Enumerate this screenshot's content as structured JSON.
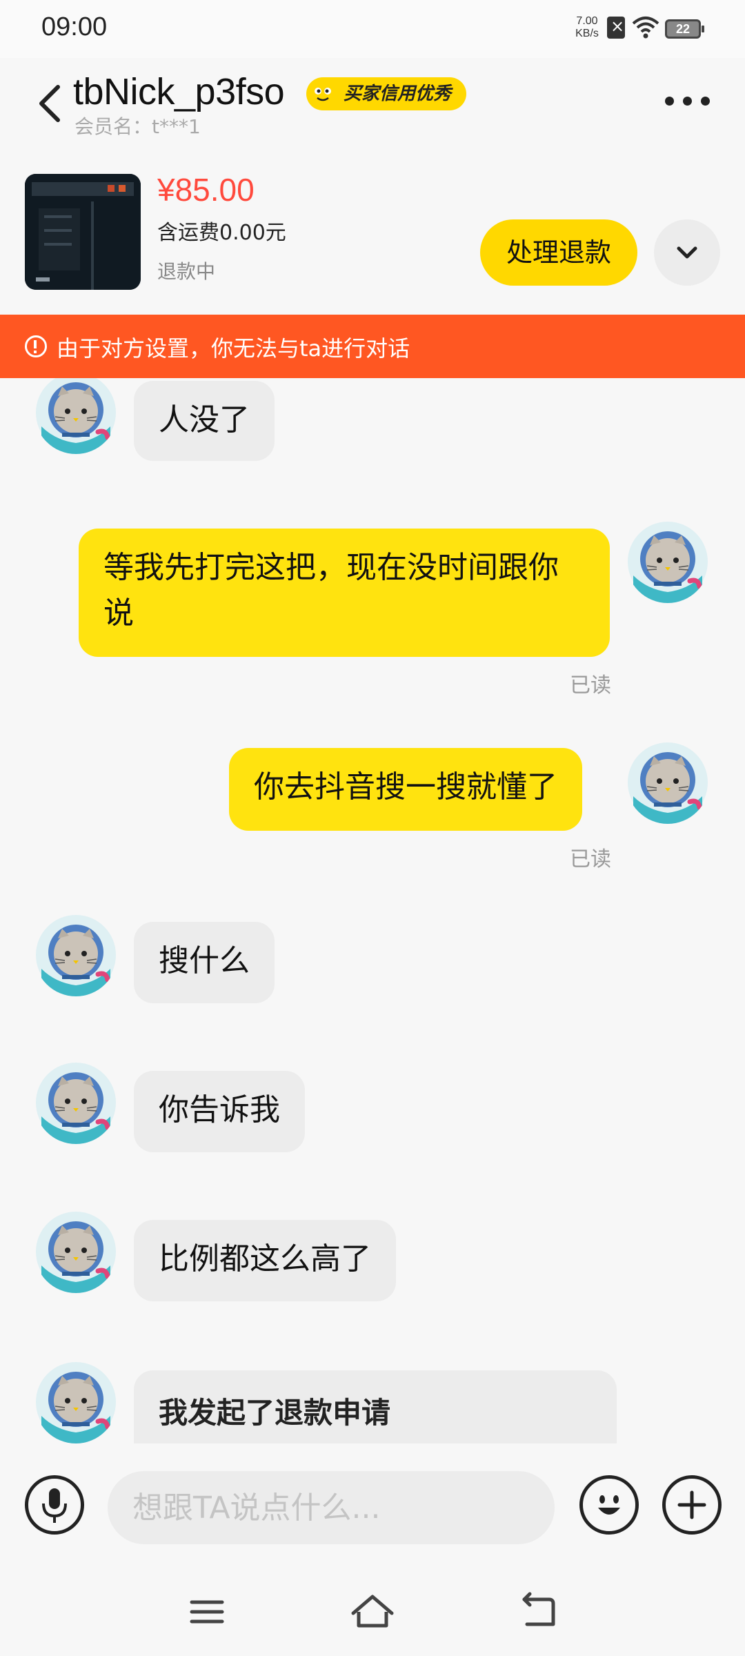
{
  "status_bar": {
    "time": "09:00",
    "net_speed_value": "7.00",
    "net_speed_unit": "KB/s",
    "battery_level": "22"
  },
  "header": {
    "nickname": "tbNick_p3fso",
    "credit_badge": "买家信用优秀",
    "member_name": "会员名：t***1"
  },
  "product": {
    "price": "¥85.00",
    "shipping": "含运费0.00元",
    "status": "退款中",
    "refund_button": "处理退款"
  },
  "banner": {
    "text": "由于对方设置，你无法与ta进行对话",
    "color": "#ff5722"
  },
  "messages": [
    {
      "side": "in",
      "text": "人没了"
    },
    {
      "side": "out",
      "text": "等我先打完这把，现在没时间跟你说",
      "status": "已读"
    },
    {
      "side": "out",
      "text": "你去抖音搜一搜就懂了",
      "status": "已读"
    },
    {
      "side": "in",
      "text": "搜什么"
    },
    {
      "side": "in",
      "text": "你告诉我"
    },
    {
      "side": "in",
      "text": "比例都这么高了"
    }
  ],
  "refund_card": {
    "title": "我发起了退款申请"
  },
  "input": {
    "placeholder": "想跟TA说点什么..."
  },
  "theme": {
    "accent": "#ffd800",
    "price_color": "#ff4a3d"
  },
  "icons": [
    "back-icon",
    "more-icon",
    "chevron-down-icon",
    "warning-icon",
    "microphone-icon",
    "emoji-icon",
    "plus-icon",
    "menu-icon",
    "home-icon",
    "back-nav-icon"
  ]
}
